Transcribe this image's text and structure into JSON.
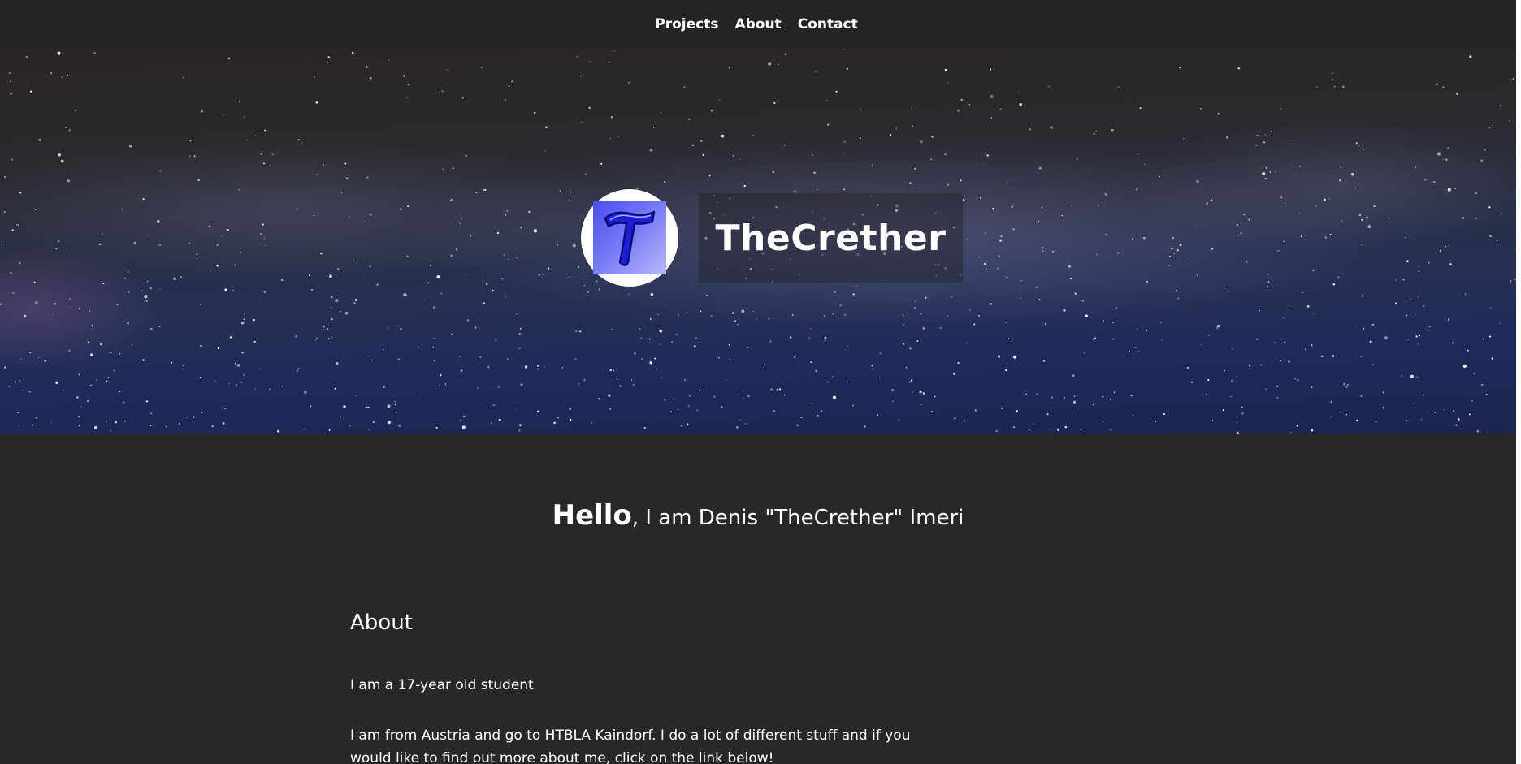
{
  "nav": {
    "items": [
      {
        "label": "Projects"
      },
      {
        "label": "About"
      },
      {
        "label": "Contact"
      }
    ]
  },
  "hero": {
    "title": "TheCrether",
    "avatar_letter": "T"
  },
  "greeting": {
    "strong": "Hello",
    "rest": ", I am Denis \"TheCrether\" Imeri"
  },
  "about": {
    "heading": "About",
    "paragraphs": [
      "I am a 17-year old student",
      "I am from Austria and go to HTBLA Kaindorf. I do a lot of different stuff and if you would like to find out more about me, click on the link below!"
    ]
  },
  "colors": {
    "background": "#2a2727",
    "navbar": "#262323",
    "text": "#ffffff",
    "avatar_accent": "#4a4ef0"
  }
}
